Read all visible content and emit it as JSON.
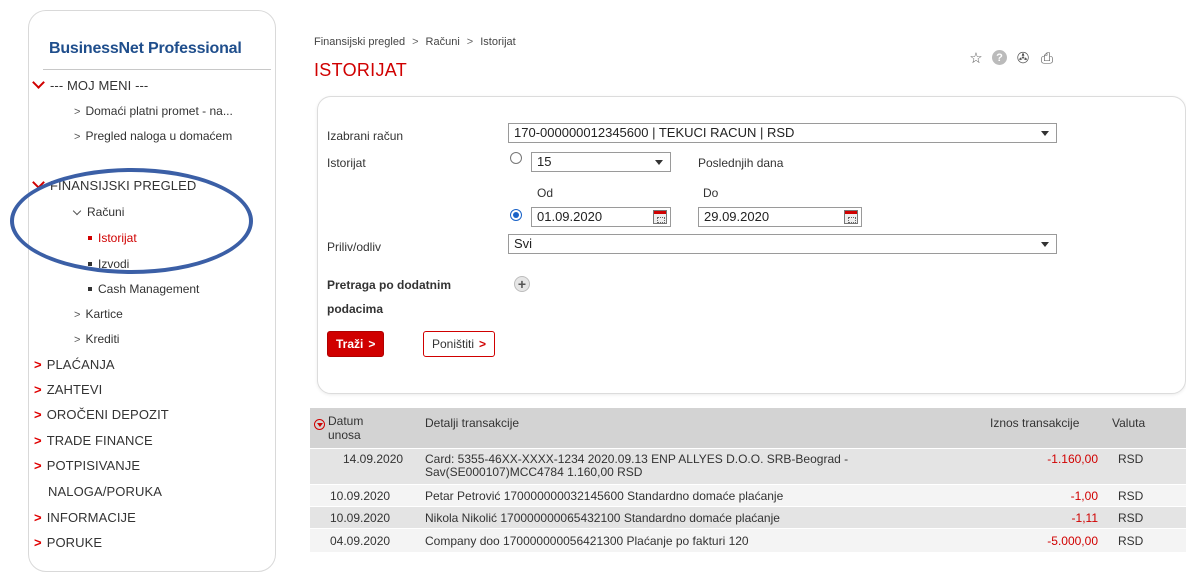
{
  "sidebar": {
    "brand": "BusinessNet Professional",
    "my_menu": "--- MOJ MENI ---",
    "my_menu_items": [
      "Domaći platni promet - na...",
      "Pregled naloga u domaćem"
    ],
    "financial_overview": "FINANSIJSKI PREGLED",
    "accounts": "Računi",
    "accounts_children": [
      "Istorijat",
      "Izvodi",
      "Cash Management"
    ],
    "cards": "Kartice",
    "loans": "Krediti",
    "sections": [
      "PLAĆANJA",
      "ZAHTEVI",
      "OROČENI DEPOZIT",
      "TRADE FINANCE",
      "POTPISIVANJE",
      "INFORMACIJE",
      "PORUKE"
    ],
    "signing_line2": "NALOGA/PORUKA",
    "highlight_color": "#3b5fa6"
  },
  "breadcrumb": [
    "Finansijski pregled",
    "Računi",
    "Istorijat"
  ],
  "breadcrumb_sep": ">",
  "page_title": "ISTORIJAT",
  "toolbar_icons": [
    "star-icon",
    "help-icon",
    "fax-icon",
    "print-icon"
  ],
  "toolbar_symbols": {
    "star": "☆",
    "help": "?",
    "fax": "✇",
    "print": "⎙"
  },
  "filter": {
    "account_label": "Izabrani račun",
    "account_value": "170-000000012345600 | TEKUCI RACUN | RSD",
    "history_label": "Istorijat",
    "days_value": "15",
    "days_suffix": "Poslednjih dana",
    "from_label": "Od",
    "to_label": "Do",
    "from_date": "01.09.2020",
    "to_date": "29.09.2020",
    "flow_label": "Priliv/odliv",
    "flow_value": "Svi",
    "extra_search_line1": "Pretraga po dodatnim",
    "extra_search_line2": "podacima",
    "search_button": "Traži",
    "reset_button": "Poništiti",
    "button_arrow": ">"
  },
  "table": {
    "headers": {
      "date_line1": "Datum",
      "date_line2": "unosa",
      "details": "Detalji transakcije",
      "amount": "Iznos transakcije",
      "currency": "Valuta"
    },
    "rows": [
      {
        "date": "14.09.2020",
        "details1": "Card: 5355-46XX-XXXX-1234  2020.09.13 ENP ALLYES D.O.O. SRB-Beograd -",
        "details2": "Sav(SE000107)MCC4784 1.160,00 RSD",
        "amount": "-1.160,00",
        "currency": "RSD"
      },
      {
        "date": "10.09.2020",
        "details1": "Petar Petrović 170000000032145600  Standardno domaće plaćanje",
        "details2": "",
        "amount": "-1,00",
        "currency": "RSD"
      },
      {
        "date": "10.09.2020",
        "details1": "Nikola Nikolić 170000000065432100  Standardno domaće plaćanje",
        "details2": "",
        "amount": "-1,11",
        "currency": "RSD"
      },
      {
        "date": "04.09.2020",
        "details1": "Company doo 170000000056421300  Plaćanje po fakturi 120",
        "details2": "",
        "amount": "-5.000,00",
        "currency": "RSD"
      }
    ]
  },
  "colors": {
    "accent_red": "#d00000",
    "brand_blue": "#1f4e8c",
    "radio_blue": "#1a63c8"
  }
}
